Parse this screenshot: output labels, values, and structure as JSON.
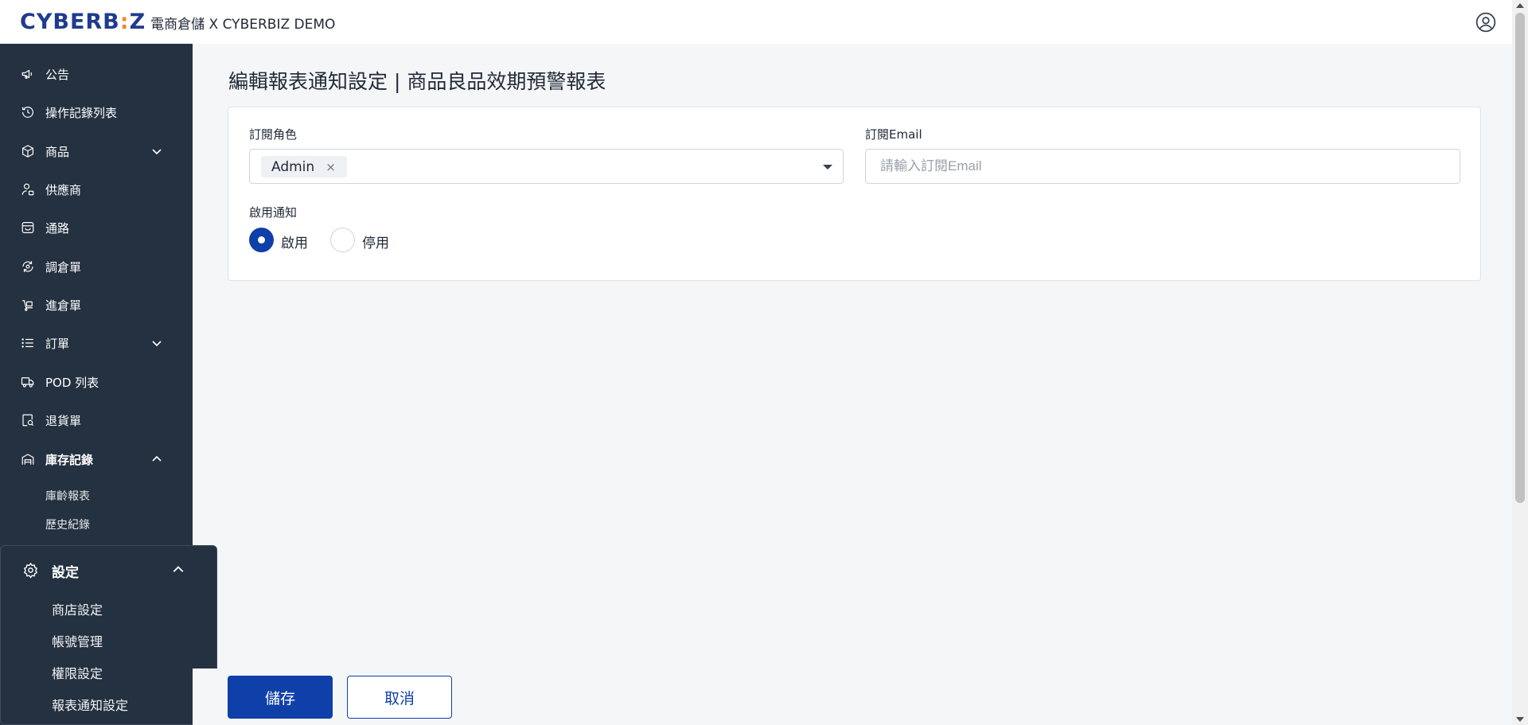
{
  "header": {
    "logo_main": "CYBERB",
    "logo_accent": ":",
    "logo_end": "Z",
    "app_title": "電商倉儲 X CYBERBIZ DEMO",
    "user_icon": "user-circle-icon"
  },
  "sidebar": {
    "items": [
      {
        "label": "公告",
        "icon": "megaphone-icon"
      },
      {
        "label": "操作記錄列表",
        "icon": "history-icon"
      },
      {
        "label": "商品",
        "icon": "box-icon",
        "expandable": true
      },
      {
        "label": "供應商",
        "icon": "supplier-icon"
      },
      {
        "label": "通路",
        "icon": "store-icon"
      },
      {
        "label": "調倉單",
        "icon": "transfer-icon"
      },
      {
        "label": "進倉單",
        "icon": "inbound-icon"
      },
      {
        "label": "訂單",
        "icon": "list-icon",
        "expandable": true
      },
      {
        "label": "POD 列表",
        "icon": "truck-icon"
      },
      {
        "label": "退貨單",
        "icon": "return-icon"
      },
      {
        "label": "庫存記錄",
        "icon": "warehouse-icon",
        "expanded": true
      }
    ],
    "inventory_sub": [
      "庫齡報表",
      "歷史紀錄"
    ],
    "settings": {
      "label": "設定",
      "icon": "gear-icon",
      "sub": [
        "商店設定",
        "帳號管理",
        "權限設定",
        "報表通知設定"
      ]
    }
  },
  "main": {
    "title": "編輯報表通知設定 | 商品良品效期預警報表",
    "role_label": "訂閱角色",
    "role_chip": "Admin",
    "chip_remove": "×",
    "email_label": "訂閱Email",
    "email_placeholder": "請輸入訂閱Email",
    "email_value": "",
    "enable_label": "啟用通知",
    "radio_on": "啟用",
    "radio_off": "停用",
    "enabled": true
  },
  "footer": {
    "save": "儲存",
    "cancel": "取消"
  },
  "colors": {
    "primary": "#0f3fa8",
    "sidebar_bg": "#243140",
    "logo_blue": "#1f3b8f",
    "logo_orange": "#f08a24"
  }
}
